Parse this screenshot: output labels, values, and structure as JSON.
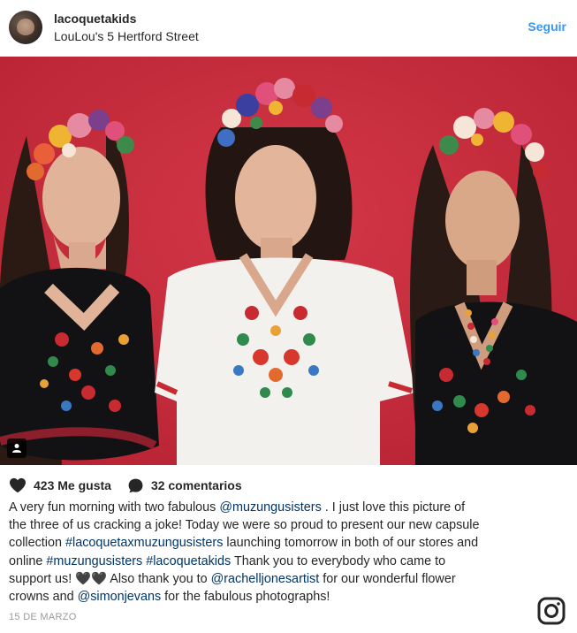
{
  "post": {
    "username": "lacoquetakids",
    "location": "LouLou's 5 Hertford Street",
    "follow_label": "Seguir",
    "likes_label": "423 Me gusta",
    "comments_label": "32 comentarios",
    "date": "15 DE MARZO",
    "caption": {
      "line1": {
        "a": "A very fun morning with two fabulous ",
        "m1": "@muzungusisters",
        "b": " . I just love this picture of"
      },
      "line2": {
        "a": "the three of us cracking a joke! Today we were so proud to present our new capsule"
      },
      "line3": {
        "a": "collection ",
        "h1": "#lacoquetaxmuzungusisters",
        "b": " launching tomorrow in both of our stores and"
      },
      "line4": {
        "a": "online ",
        "h2": "#muzungusisters",
        "sp": " ",
        "h3": "#lacoquetakids",
        "b": " Thank you to everybody who came to"
      },
      "line5": {
        "a": "support us! ",
        "hearts": "🖤🖤",
        "b": " Also thank you to ",
        "m2": "@rachelljonesartist",
        "c": " for our wonderful flower"
      },
      "line6": {
        "a": "crowns and ",
        "m3": "@simonjevans",
        "b": " for the fabulous photographs!"
      }
    }
  },
  "icons": {
    "heart": "heart-icon",
    "comment": "comment-icon",
    "person_tag": "person-tag-icon",
    "instagram": "instagram-icon"
  },
  "colors": {
    "link_blue": "#3897f0",
    "mention": "#003569",
    "backdrop_red": "#c62b39",
    "date_gray": "#999999"
  }
}
